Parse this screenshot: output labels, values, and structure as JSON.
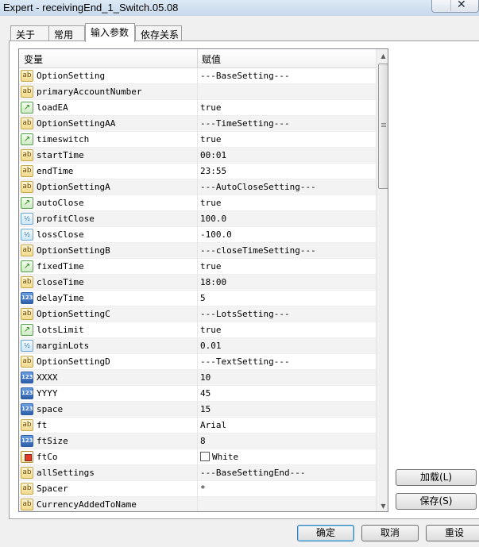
{
  "window": {
    "title": "Expert - receivingEnd_1_Switch.05.08",
    "close_label": "✕"
  },
  "tabs": [
    {
      "label": "关于"
    },
    {
      "label": "常用"
    },
    {
      "label": "输入参数"
    },
    {
      "label": "依存关系"
    }
  ],
  "grid": {
    "col_variable": "变量",
    "col_value": "赋值",
    "rows": [
      {
        "icon": "string-icon",
        "icon_text": "ab",
        "name": "OptionSetting",
        "value": "---BaseSetting---"
      },
      {
        "icon": "string-icon",
        "icon_text": "ab",
        "name": "primaryAccountNumber",
        "value": ""
      },
      {
        "icon": "bool-icon",
        "icon_text": "↗",
        "name": "loadEA",
        "value": "true"
      },
      {
        "icon": "string-icon",
        "icon_text": "ab",
        "name": "OptionSettingAA",
        "value": "---TimeSetting---"
      },
      {
        "icon": "bool-icon",
        "icon_text": "↗",
        "name": "timeswitch",
        "value": "true"
      },
      {
        "icon": "string-icon",
        "icon_text": "ab",
        "name": "startTime",
        "value": "00:01"
      },
      {
        "icon": "string-icon",
        "icon_text": "ab",
        "name": "endTime",
        "value": "23:55"
      },
      {
        "icon": "string-icon",
        "icon_text": "ab",
        "name": "OptionSettingA",
        "value": "---AutoCloseSetting---"
      },
      {
        "icon": "bool-icon",
        "icon_text": "↗",
        "name": "autoClose",
        "value": "true"
      },
      {
        "icon": "double-icon",
        "icon_text": "½",
        "name": "profitClose",
        "value": "100.0"
      },
      {
        "icon": "double-icon",
        "icon_text": "½",
        "name": "lossClose",
        "value": "-100.0"
      },
      {
        "icon": "string-icon",
        "icon_text": "ab",
        "name": "OptionSettingB",
        "value": "---closeTimeSetting---"
      },
      {
        "icon": "bool-icon",
        "icon_text": "↗",
        "name": "fixedTime",
        "value": "true"
      },
      {
        "icon": "string-icon",
        "icon_text": "ab",
        "name": "closeTime",
        "value": "18:00"
      },
      {
        "icon": "int-icon",
        "icon_text": "123",
        "name": "delayTime",
        "value": "5"
      },
      {
        "icon": "string-icon",
        "icon_text": "ab",
        "name": "OptionSettingC",
        "value": "---LotsSetting---"
      },
      {
        "icon": "bool-icon",
        "icon_text": "↗",
        "name": "lotsLimit",
        "value": "true"
      },
      {
        "icon": "double-icon",
        "icon_text": "½",
        "name": "marginLots",
        "value": "0.01"
      },
      {
        "icon": "string-icon",
        "icon_text": "ab",
        "name": "OptionSettingD",
        "value": "---TextSetting---"
      },
      {
        "icon": "int-icon",
        "icon_text": "123",
        "name": "XXXX",
        "value": "10"
      },
      {
        "icon": "int-icon",
        "icon_text": "123",
        "name": "YYYY",
        "value": "45"
      },
      {
        "icon": "int-icon",
        "icon_text": "123",
        "name": "space",
        "value": "15"
      },
      {
        "icon": "string-icon",
        "icon_text": "ab",
        "name": "ft",
        "value": "Arial"
      },
      {
        "icon": "int-icon",
        "icon_text": "123",
        "name": "ftSize",
        "value": "8"
      },
      {
        "icon": "color-icon",
        "icon_text": "",
        "name": "ftCo",
        "value": "White"
      },
      {
        "icon": "string-icon",
        "icon_text": "ab",
        "name": "allSettings",
        "value": "---BaseSettingEnd---"
      },
      {
        "icon": "string-icon",
        "icon_text": "ab",
        "name": "Spacer",
        "value": "*"
      },
      {
        "icon": "string-icon",
        "icon_text": "ab",
        "name": "CurrencyAddedToName",
        "value": ""
      }
    ]
  },
  "side_buttons": {
    "load": "加载(L)",
    "save": "保存(S)"
  },
  "footer": {
    "ok": "确定",
    "cancel": "取消",
    "reset": "重设"
  }
}
